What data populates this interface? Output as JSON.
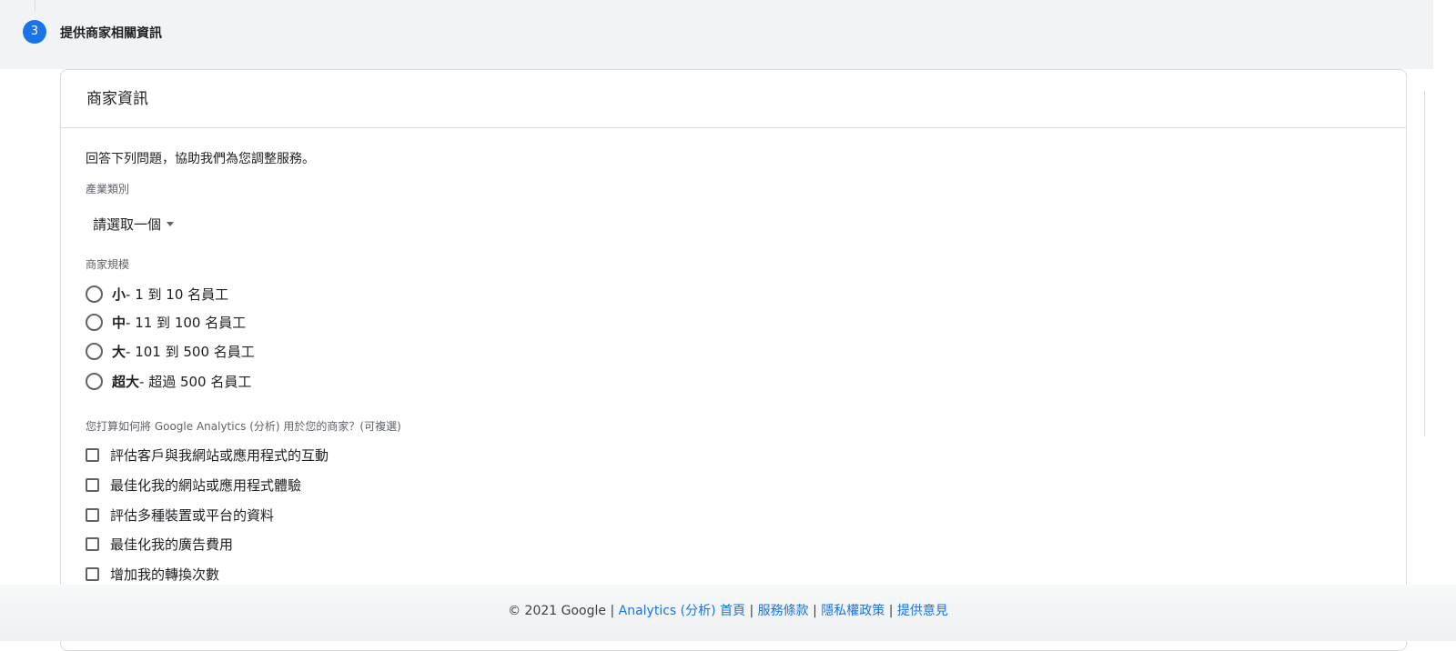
{
  "stepper": {
    "step_number": "3",
    "step_title": "提供商家相關資訊"
  },
  "card": {
    "title": "商家資訊",
    "intro": "回答下列問題，協助我們為您調整服務。",
    "industry": {
      "label": "產業類別",
      "selected": "請選取一個"
    },
    "size": {
      "label": "商家規模",
      "options": [
        {
          "name": "小",
          "detail": " - 1 到 10 名員工"
        },
        {
          "name": "中",
          "detail": " - 11 到 100 名員工"
        },
        {
          "name": "大",
          "detail": " - 101 到 500 名員工"
        },
        {
          "name": "超大",
          "detail": " - 超過 500 名員工"
        }
      ]
    },
    "usage": {
      "label": "您打算如何將 Google Analytics (分析) 用於您的商家？(可複選)",
      "options": [
        "評估客戶與我網站或應用程式的互動",
        "最佳化我的網站或應用程式體驗",
        "評估多種裝置或平台的資料",
        "最佳化我的廣告費用",
        "增加我的轉換次數"
      ]
    }
  },
  "footer": {
    "copyright": "© 2021 Google",
    "links": [
      "Analytics (分析) 首頁",
      "服務條款",
      "隱私權政策",
      "提供意見"
    ],
    "separator": "|"
  },
  "colors": {
    "accent": "#1a73e8",
    "stepper_bg": "#f1f3f4",
    "border": "#dadce0"
  }
}
